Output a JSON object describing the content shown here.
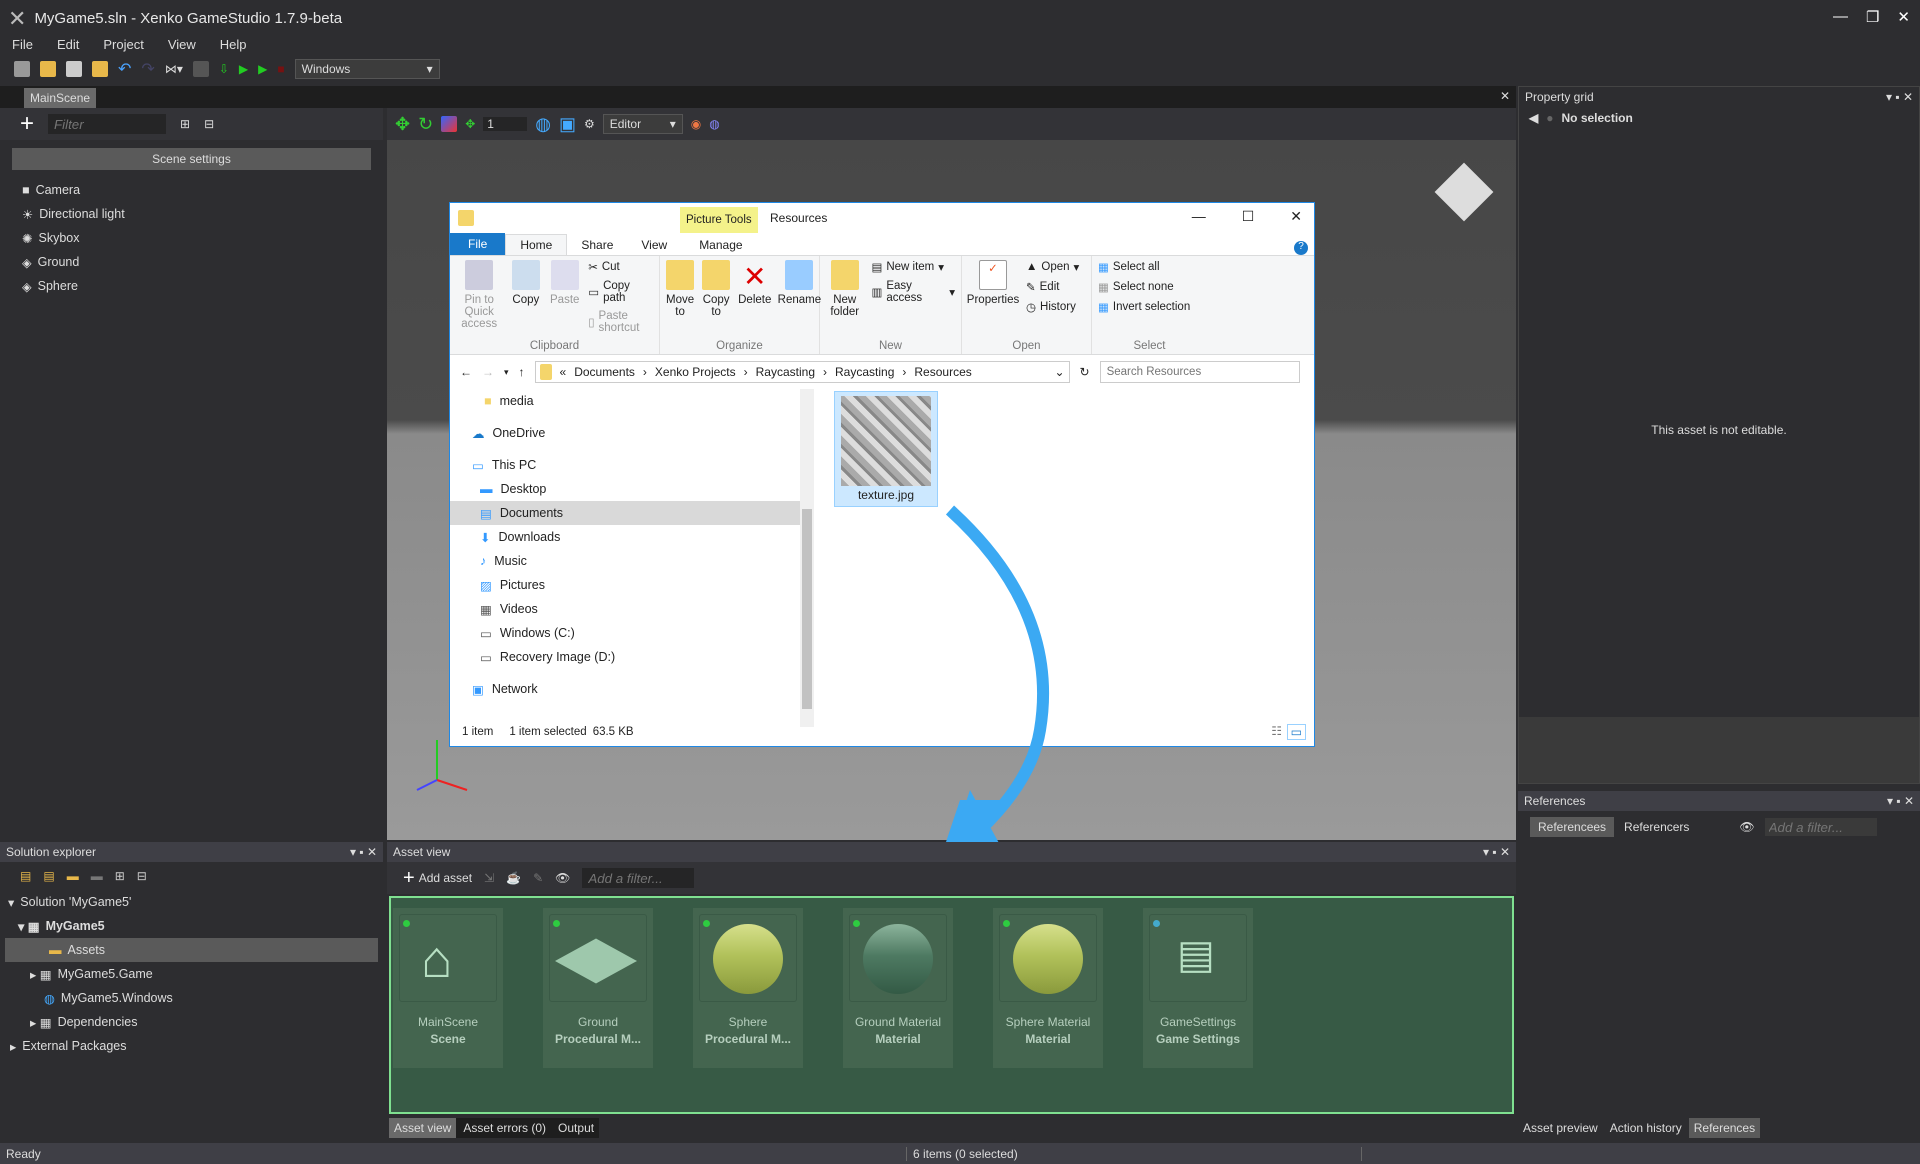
{
  "window": {
    "title": "MyGame5.sln - Xenko GameStudio 1.7.9-beta"
  },
  "menu": [
    "File",
    "Edit",
    "Project",
    "View",
    "Help"
  ],
  "toolbar": {
    "platform": "Windows"
  },
  "doc_tab": "MainScene",
  "scene": {
    "filter_placeholder": "Filter",
    "settings_button": "Scene settings",
    "editor_mode": "Editor",
    "snap_value": "1",
    "entities": [
      "Camera",
      "Directional light",
      "Skybox",
      "Ground",
      "Sphere"
    ]
  },
  "explorer": {
    "title": "Resources",
    "picture_tools": "Picture Tools",
    "tabs": [
      "File",
      "Home",
      "Share",
      "View",
      "Manage"
    ],
    "clipboard": {
      "pin": "Pin to Quick access",
      "copy": "Copy",
      "paste": "Paste",
      "cut": "Cut",
      "copy_path": "Copy path",
      "paste_shortcut": "Paste shortcut",
      "label": "Clipboard"
    },
    "organize": {
      "move": "Move to",
      "copy": "Copy to",
      "delete": "Delete",
      "rename": "Rename",
      "label": "Organize"
    },
    "new": {
      "folder": "New folder",
      "item": "New item",
      "easy": "Easy access",
      "label": "New"
    },
    "open": {
      "properties": "Properties",
      "open": "Open",
      "edit": "Edit",
      "history": "History",
      "label": "Open"
    },
    "select": {
      "all": "Select all",
      "none": "Select none",
      "invert": "Invert selection",
      "label": "Select"
    },
    "path": [
      "Documents",
      "Xenko Projects",
      "Raycasting",
      "Raycasting",
      "Resources"
    ],
    "search_placeholder": "Search Resources",
    "nav": [
      "media",
      "OneDrive",
      "This PC",
      "Desktop",
      "Documents",
      "Downloads",
      "Music",
      "Pictures",
      "Videos",
      "Windows (C:)",
      "Recovery Image (D:)",
      "Network"
    ],
    "file": "texture.jpg",
    "status": {
      "count": "1 item",
      "selected": "1 item selected",
      "size": "63.5 KB"
    }
  },
  "property_grid": {
    "title": "Property grid",
    "selection": "No selection",
    "message": "This asset is not editable."
  },
  "references": {
    "title": "References",
    "tabs": [
      "Referencees",
      "Referencers"
    ],
    "filter_placeholder": "Add a filter..."
  },
  "solution": {
    "title": "Solution explorer",
    "items": [
      "Solution 'MyGame5'",
      "MyGame5",
      "Assets",
      "MyGame5.Game",
      "MyGame5.Windows",
      "Dependencies",
      "External Packages"
    ]
  },
  "asset_view": {
    "title": "Asset view",
    "add": "Add asset",
    "filter_placeholder": "Add a filter...",
    "assets": [
      {
        "name": "MainScene",
        "type": "Scene"
      },
      {
        "name": "Ground",
        "type": "Procedural M..."
      },
      {
        "name": "Sphere",
        "type": "Procedural M..."
      },
      {
        "name": "Ground Material",
        "type": "Material"
      },
      {
        "name": "Sphere Material",
        "type": "Material"
      },
      {
        "name": "GameSettings",
        "type": "Game Settings"
      }
    ],
    "bottom_tabs": [
      "Asset view",
      "Asset errors (0)",
      "Output"
    ]
  },
  "right_bottom_tabs": [
    "Asset preview",
    "Action history",
    "References"
  ],
  "status": {
    "left": "Ready",
    "center": "6 items (0 selected)"
  }
}
